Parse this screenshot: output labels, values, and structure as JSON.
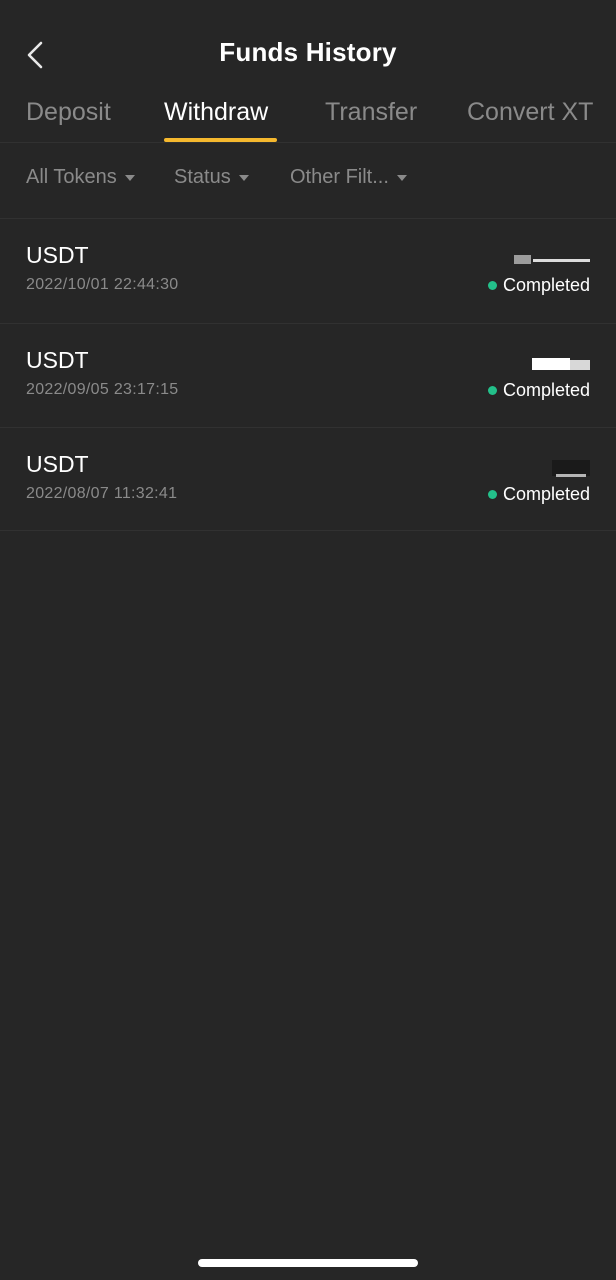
{
  "header": {
    "title": "Funds History",
    "back_icon": "chevron-left-icon"
  },
  "tabs": [
    {
      "label": "Deposit",
      "active": false
    },
    {
      "label": "Withdraw",
      "active": true
    },
    {
      "label": "Transfer",
      "active": false
    },
    {
      "label": "Convert XT",
      "active": false
    }
  ],
  "filters": [
    {
      "label": "All Tokens"
    },
    {
      "label": "Status"
    },
    {
      "label": "Other Filt..."
    }
  ],
  "records": [
    {
      "token": "USDT",
      "time": "2022/10/01 22:44:30",
      "status": "Completed"
    },
    {
      "token": "USDT",
      "time": "2022/09/05 23:17:15",
      "status": "Completed"
    },
    {
      "token": "USDT",
      "time": "2022/08/07 11:32:41",
      "status": "Completed"
    }
  ],
  "colors": {
    "background": "#262626",
    "accent": "#f5b82e",
    "status_completed": "#23c08a",
    "muted_text": "#8a8a8a"
  }
}
